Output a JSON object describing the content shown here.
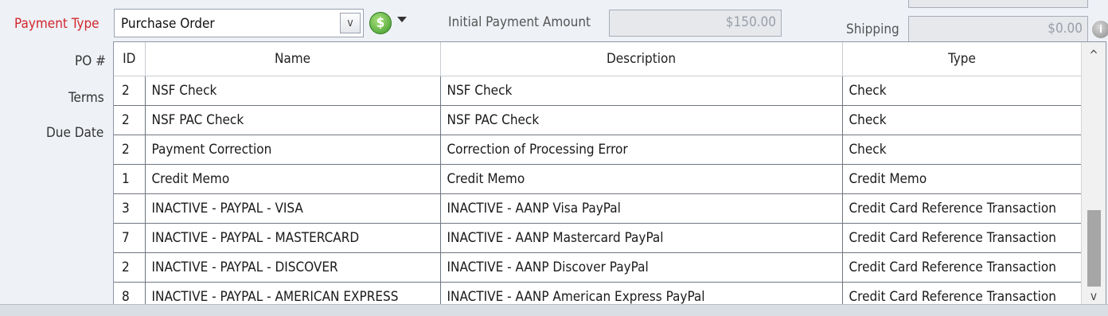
{
  "form": {
    "payment_type_label": "Payment Type",
    "payment_type_value": "Purchase Order",
    "po_label": "PO #",
    "terms_label": "Terms",
    "due_date_label": "Due Date",
    "initial_payment_label": "Initial Payment Amount",
    "initial_payment_value": "$150.00",
    "shipping_label": "Shipping",
    "shipping_value": "$0.00"
  },
  "grid": {
    "columns": [
      "ID",
      "Name",
      "Description",
      "Type"
    ],
    "rows": [
      [
        "2",
        "NSF Check",
        "NSF Check",
        "Check"
      ],
      [
        "2",
        "NSF PAC Check",
        "NSF PAC Check",
        "Check"
      ],
      [
        "2",
        "Payment Correction",
        "Correction of Processing Error",
        "Check"
      ],
      [
        "1",
        "Credit Memo",
        "Credit Memo",
        "Credit Memo"
      ],
      [
        "3",
        "INACTIVE - PAYPAL - VISA",
        "INACTIVE - AANP Visa PayPal",
        "Credit Card Reference Transaction"
      ],
      [
        "7",
        "INACTIVE - PAYPAL - MASTERCARD",
        "INACTIVE - AANP Mastercard PayPal",
        "Credit Card Reference Transaction"
      ],
      [
        "2",
        "INACTIVE - PAYPAL - DISCOVER",
        "INACTIVE - AANP Discover PayPal",
        "Credit Card Reference Transaction"
      ],
      [
        "8",
        "INACTIVE - PAYPAL - AMERICAN EXPRESS",
        "INACTIVE - AANP American Express PayPal",
        "Credit Card Reference Transaction"
      ]
    ]
  },
  "icons": {
    "dollar": "$",
    "info": "i",
    "scroll_up": "^",
    "scroll_down": "v",
    "dropdown_arrow": "v"
  },
  "colors": {
    "required_label": "#d2262c",
    "dollar_icon": "#3e9a2a"
  }
}
